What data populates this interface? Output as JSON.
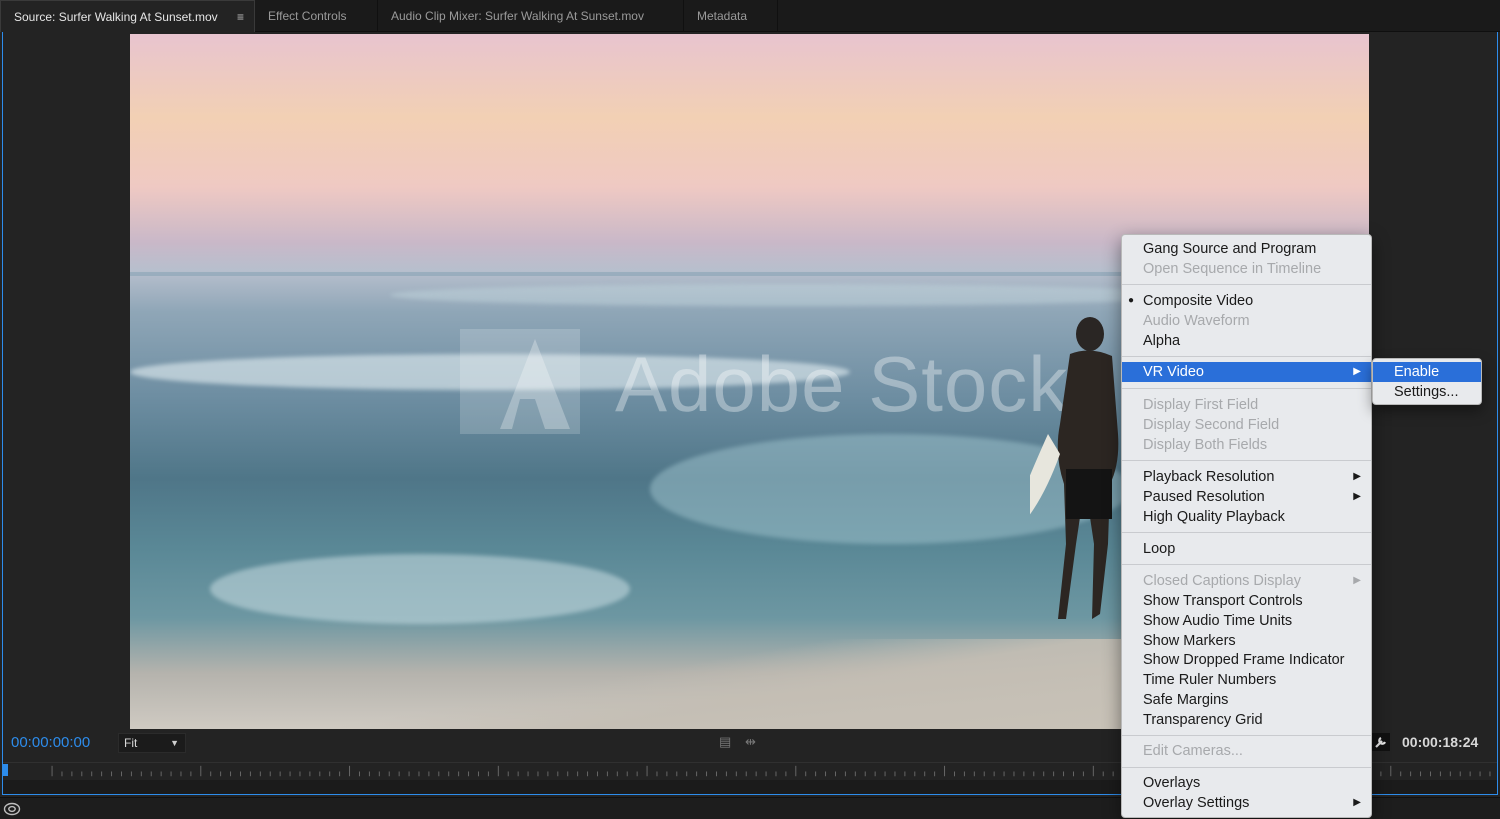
{
  "tabs": [
    {
      "label": "Source: Surfer Walking At Sunset.mov",
      "active": true
    },
    {
      "label": "Effect Controls",
      "active": false
    },
    {
      "label": "Audio Clip Mixer: Surfer Walking At Sunset.mov",
      "active": false
    },
    {
      "label": "Metadata",
      "active": false
    }
  ],
  "video": {
    "watermark": "Adobe Stock"
  },
  "controls": {
    "playhead_timecode": "00:00:00:00",
    "duration_timecode": "00:00:18:24",
    "fit_value": "Fit"
  },
  "context_menu": {
    "items": [
      {
        "label": "Gang Source and Program",
        "enabled": true
      },
      {
        "label": "Open Sequence in Timeline",
        "enabled": false
      },
      {
        "label": "Composite Video",
        "enabled": true,
        "checked": true
      },
      {
        "label": "Audio Waveform",
        "enabled": false
      },
      {
        "label": "Alpha",
        "enabled": true
      },
      {
        "label": "VR Video",
        "enabled": true,
        "highlighted": true,
        "has_submenu": true
      },
      {
        "label": "Display First Field",
        "enabled": false
      },
      {
        "label": "Display Second Field",
        "enabled": false
      },
      {
        "label": "Display Both Fields",
        "enabled": false
      },
      {
        "label": "Playback Resolution",
        "enabled": true,
        "has_submenu": true
      },
      {
        "label": "Paused Resolution",
        "enabled": true,
        "has_submenu": true
      },
      {
        "label": "High Quality Playback",
        "enabled": true
      },
      {
        "label": "Loop",
        "enabled": true
      },
      {
        "label": "Closed Captions Display",
        "enabled": false,
        "has_submenu": true
      },
      {
        "label": "Show Transport Controls",
        "enabled": true
      },
      {
        "label": "Show Audio Time Units",
        "enabled": true
      },
      {
        "label": "Show Markers",
        "enabled": true
      },
      {
        "label": "Show Dropped Frame Indicator",
        "enabled": true
      },
      {
        "label": "Time Ruler Numbers",
        "enabled": true
      },
      {
        "label": "Safe Margins",
        "enabled": true
      },
      {
        "label": "Transparency Grid",
        "enabled": true
      },
      {
        "label": "Edit Cameras...",
        "enabled": false
      },
      {
        "label": "Overlays",
        "enabled": true
      },
      {
        "label": "Overlay Settings",
        "enabled": true,
        "has_submenu": true
      }
    ],
    "submenu_arrow": "▶",
    "checked_bullet": "●"
  },
  "vr_submenu": {
    "items": [
      {
        "label": "Enable",
        "highlighted": true
      },
      {
        "label": "Settings...",
        "highlighted": false
      }
    ]
  },
  "colors": {
    "accent_blue": "#2d8ceb",
    "menu_highlight": "#2a6fd9",
    "menu_background": "#e8eaed"
  }
}
